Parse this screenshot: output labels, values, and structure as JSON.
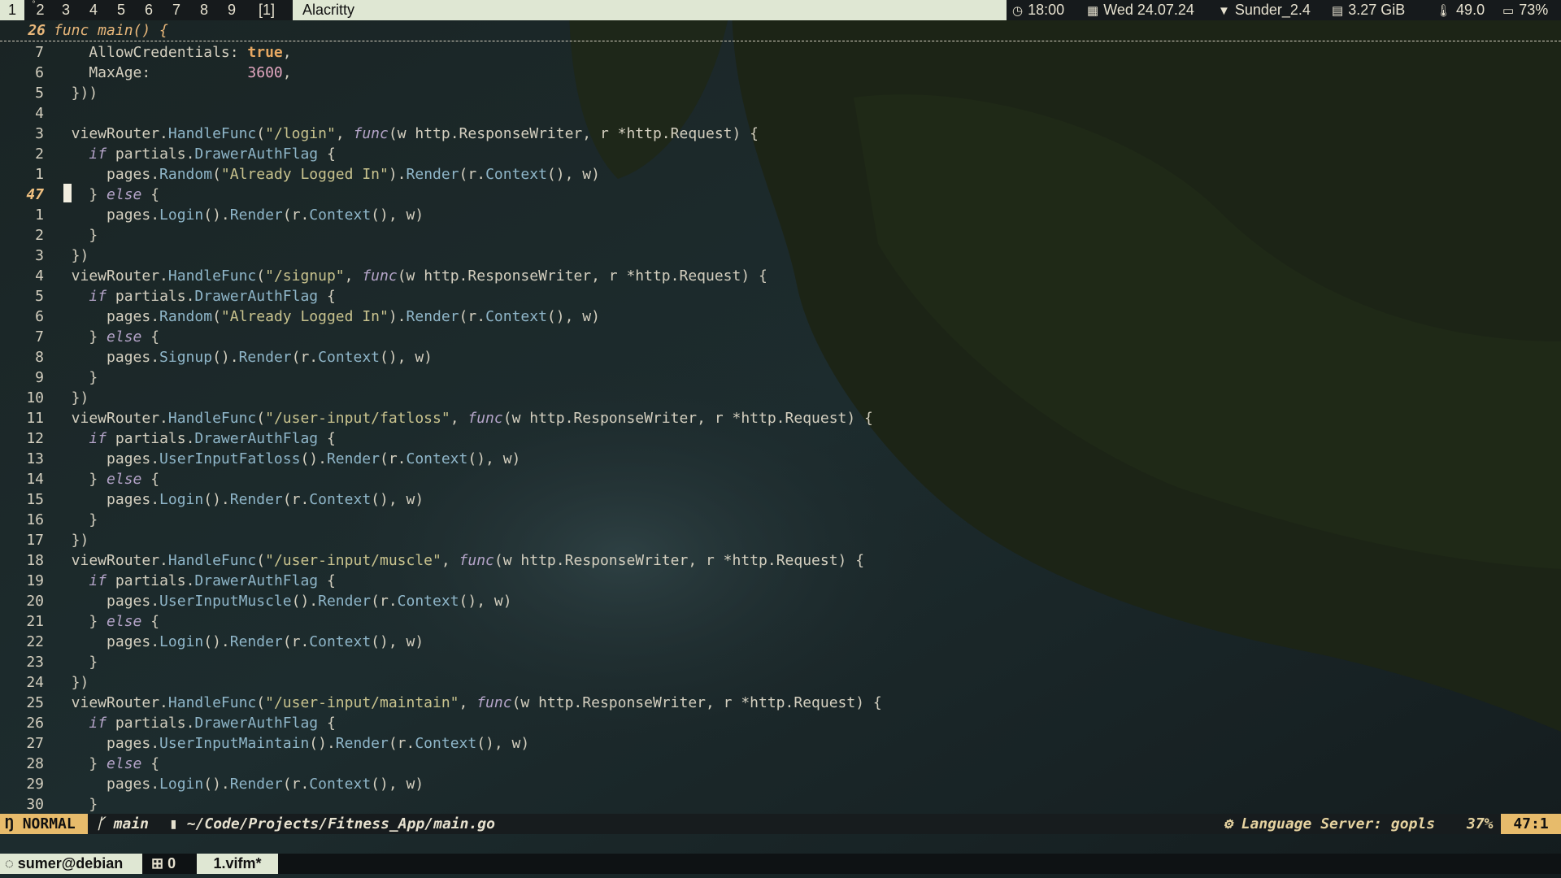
{
  "topbar": {
    "workspaces": [
      {
        "label": "1",
        "active": true
      },
      {
        "label": "2",
        "active": false,
        "sup": "°"
      },
      {
        "label": "3",
        "active": false
      },
      {
        "label": "4",
        "active": false
      },
      {
        "label": "5",
        "active": false
      },
      {
        "label": "6",
        "active": false
      },
      {
        "label": "7",
        "active": false
      },
      {
        "label": "8",
        "active": false
      },
      {
        "label": "9",
        "active": false
      },
      {
        "label": "[1]",
        "active": false
      }
    ],
    "window_title": "Alacritty",
    "status": {
      "time": "18:00",
      "date": "Wed 24.07.24",
      "wifi": "Sunder_2.4",
      "memory": "3.27 GiB",
      "temperature": "49.0",
      "battery": "73%"
    },
    "icons": {
      "clock": "clock-icon",
      "calendar": "calendar-icon",
      "wifi": "wifi-icon",
      "memory": "memory-icon",
      "temperature": "thermometer-icon",
      "battery": "battery-icon"
    }
  },
  "winbar": {
    "line_number": "26",
    "text": "func main() {"
  },
  "editor": {
    "lines": [
      {
        "n": "7",
        "tokens": [
          [
            "id",
            "    AllowCredentials: "
          ],
          [
            "bool",
            "true"
          ],
          [
            "id",
            ","
          ]
        ]
      },
      {
        "n": "6",
        "tokens": [
          [
            "id",
            "    MaxAge:           "
          ],
          [
            "numl",
            "3600"
          ],
          [
            "id",
            ","
          ]
        ]
      },
      {
        "n": "5",
        "tokens": [
          [
            "id",
            "  }))"
          ]
        ]
      },
      {
        "n": "4",
        "tokens": []
      },
      {
        "n": "3",
        "tokens": [
          [
            "id",
            "  viewRouter."
          ],
          [
            "fn",
            "HandleFunc"
          ],
          [
            "id",
            "("
          ],
          [
            "str",
            "\"/login\""
          ],
          [
            "id",
            ", "
          ],
          [
            "kw",
            "func"
          ],
          [
            "id",
            "(w http.ResponseWriter, r *http.Request) {"
          ]
        ]
      },
      {
        "n": "2",
        "tokens": [
          [
            "id",
            "    "
          ],
          [
            "kw",
            "if"
          ],
          [
            "id",
            " partials."
          ],
          [
            "fn",
            "DrawerAuthFlag"
          ],
          [
            "id",
            " {"
          ]
        ]
      },
      {
        "n": "1",
        "tokens": [
          [
            "id",
            "      pages."
          ],
          [
            "fn",
            "Random"
          ],
          [
            "id",
            "("
          ],
          [
            "str",
            "\"Already Logged In\""
          ],
          [
            "id",
            ")."
          ],
          [
            "fn",
            "Render"
          ],
          [
            "id",
            "(r."
          ],
          [
            "fn",
            "Context"
          ],
          [
            "id",
            "(), w)"
          ]
        ]
      },
      {
        "n": "47",
        "current": true,
        "tokens": [
          [
            "id",
            "    } "
          ],
          [
            "kw",
            "else"
          ],
          [
            "id",
            " {"
          ]
        ]
      },
      {
        "n": "1",
        "tokens": [
          [
            "id",
            "      pages."
          ],
          [
            "fn",
            "Login"
          ],
          [
            "id",
            "()."
          ],
          [
            "fn",
            "Render"
          ],
          [
            "id",
            "(r."
          ],
          [
            "fn",
            "Context"
          ],
          [
            "id",
            "(), w)"
          ]
        ]
      },
      {
        "n": "2",
        "tokens": [
          [
            "id",
            "    }"
          ]
        ]
      },
      {
        "n": "3",
        "tokens": [
          [
            "id",
            "  })"
          ]
        ]
      },
      {
        "n": "4",
        "tokens": [
          [
            "id",
            "  viewRouter."
          ],
          [
            "fn",
            "HandleFunc"
          ],
          [
            "id",
            "("
          ],
          [
            "str",
            "\"/signup\""
          ],
          [
            "id",
            ", "
          ],
          [
            "kw",
            "func"
          ],
          [
            "id",
            "(w http.ResponseWriter, r *http.Request) {"
          ]
        ]
      },
      {
        "n": "5",
        "tokens": [
          [
            "id",
            "    "
          ],
          [
            "kw",
            "if"
          ],
          [
            "id",
            " partials."
          ],
          [
            "fn",
            "DrawerAuthFlag"
          ],
          [
            "id",
            " {"
          ]
        ]
      },
      {
        "n": "6",
        "tokens": [
          [
            "id",
            "      pages."
          ],
          [
            "fn",
            "Random"
          ],
          [
            "id",
            "("
          ],
          [
            "str",
            "\"Already Logged In\""
          ],
          [
            "id",
            ")."
          ],
          [
            "fn",
            "Render"
          ],
          [
            "id",
            "(r."
          ],
          [
            "fn",
            "Context"
          ],
          [
            "id",
            "(), w)"
          ]
        ]
      },
      {
        "n": "7",
        "tokens": [
          [
            "id",
            "    } "
          ],
          [
            "kw",
            "else"
          ],
          [
            "id",
            " {"
          ]
        ]
      },
      {
        "n": "8",
        "tokens": [
          [
            "id",
            "      pages."
          ],
          [
            "fn",
            "Signup"
          ],
          [
            "id",
            "()."
          ],
          [
            "fn",
            "Render"
          ],
          [
            "id",
            "(r."
          ],
          [
            "fn",
            "Context"
          ],
          [
            "id",
            "(), w)"
          ]
        ]
      },
      {
        "n": "9",
        "tokens": [
          [
            "id",
            "    }"
          ]
        ]
      },
      {
        "n": "10",
        "tokens": [
          [
            "id",
            "  })"
          ]
        ]
      },
      {
        "n": "11",
        "tokens": [
          [
            "id",
            "  viewRouter."
          ],
          [
            "fn",
            "HandleFunc"
          ],
          [
            "id",
            "("
          ],
          [
            "str",
            "\"/user-input/fatloss\""
          ],
          [
            "id",
            ", "
          ],
          [
            "kw",
            "func"
          ],
          [
            "id",
            "(w http.ResponseWriter, r *http.Request) {"
          ]
        ]
      },
      {
        "n": "12",
        "tokens": [
          [
            "id",
            "    "
          ],
          [
            "kw",
            "if"
          ],
          [
            "id",
            " partials."
          ],
          [
            "fn",
            "DrawerAuthFlag"
          ],
          [
            "id",
            " {"
          ]
        ]
      },
      {
        "n": "13",
        "tokens": [
          [
            "id",
            "      pages."
          ],
          [
            "fn",
            "UserInputFatloss"
          ],
          [
            "id",
            "()."
          ],
          [
            "fn",
            "Render"
          ],
          [
            "id",
            "(r."
          ],
          [
            "fn",
            "Context"
          ],
          [
            "id",
            "(), w)"
          ]
        ]
      },
      {
        "n": "14",
        "tokens": [
          [
            "id",
            "    } "
          ],
          [
            "kw",
            "else"
          ],
          [
            "id",
            " {"
          ]
        ]
      },
      {
        "n": "15",
        "tokens": [
          [
            "id",
            "      pages."
          ],
          [
            "fn",
            "Login"
          ],
          [
            "id",
            "()."
          ],
          [
            "fn",
            "Render"
          ],
          [
            "id",
            "(r."
          ],
          [
            "fn",
            "Context"
          ],
          [
            "id",
            "(), w)"
          ]
        ]
      },
      {
        "n": "16",
        "tokens": [
          [
            "id",
            "    }"
          ]
        ]
      },
      {
        "n": "17",
        "tokens": [
          [
            "id",
            "  })"
          ]
        ]
      },
      {
        "n": "18",
        "tokens": [
          [
            "id",
            "  viewRouter."
          ],
          [
            "fn",
            "HandleFunc"
          ],
          [
            "id",
            "("
          ],
          [
            "str",
            "\"/user-input/muscle\""
          ],
          [
            "id",
            ", "
          ],
          [
            "kw",
            "func"
          ],
          [
            "id",
            "(w http.ResponseWriter, r *http.Request) {"
          ]
        ]
      },
      {
        "n": "19",
        "tokens": [
          [
            "id",
            "    "
          ],
          [
            "kw",
            "if"
          ],
          [
            "id",
            " partials."
          ],
          [
            "fn",
            "DrawerAuthFlag"
          ],
          [
            "id",
            " {"
          ]
        ]
      },
      {
        "n": "20",
        "tokens": [
          [
            "id",
            "      pages."
          ],
          [
            "fn",
            "UserInputMuscle"
          ],
          [
            "id",
            "()."
          ],
          [
            "fn",
            "Render"
          ],
          [
            "id",
            "(r."
          ],
          [
            "fn",
            "Context"
          ],
          [
            "id",
            "(), w)"
          ]
        ]
      },
      {
        "n": "21",
        "tokens": [
          [
            "id",
            "    } "
          ],
          [
            "kw",
            "else"
          ],
          [
            "id",
            " {"
          ]
        ]
      },
      {
        "n": "22",
        "tokens": [
          [
            "id",
            "      pages."
          ],
          [
            "fn",
            "Login"
          ],
          [
            "id",
            "()."
          ],
          [
            "fn",
            "Render"
          ],
          [
            "id",
            "(r."
          ],
          [
            "fn",
            "Context"
          ],
          [
            "id",
            "(), w)"
          ]
        ]
      },
      {
        "n": "23",
        "tokens": [
          [
            "id",
            "    }"
          ]
        ]
      },
      {
        "n": "24",
        "tokens": [
          [
            "id",
            "  })"
          ]
        ]
      },
      {
        "n": "25",
        "tokens": [
          [
            "id",
            "  viewRouter."
          ],
          [
            "fn",
            "HandleFunc"
          ],
          [
            "id",
            "("
          ],
          [
            "str",
            "\"/user-input/maintain\""
          ],
          [
            "id",
            ", "
          ],
          [
            "kw",
            "func"
          ],
          [
            "id",
            "(w http.ResponseWriter, r *http.Request) {"
          ]
        ]
      },
      {
        "n": "26",
        "tokens": [
          [
            "id",
            "    "
          ],
          [
            "kw",
            "if"
          ],
          [
            "id",
            " partials."
          ],
          [
            "fn",
            "DrawerAuthFlag"
          ],
          [
            "id",
            " {"
          ]
        ]
      },
      {
        "n": "27",
        "tokens": [
          [
            "id",
            "      pages."
          ],
          [
            "fn",
            "UserInputMaintain"
          ],
          [
            "id",
            "()."
          ],
          [
            "fn",
            "Render"
          ],
          [
            "id",
            "(r."
          ],
          [
            "fn",
            "Context"
          ],
          [
            "id",
            "(), w)"
          ]
        ]
      },
      {
        "n": "28",
        "tokens": [
          [
            "id",
            "    } "
          ],
          [
            "kw",
            "else"
          ],
          [
            "id",
            " {"
          ]
        ]
      },
      {
        "n": "29",
        "tokens": [
          [
            "id",
            "      pages."
          ],
          [
            "fn",
            "Login"
          ],
          [
            "id",
            "()."
          ],
          [
            "fn",
            "Render"
          ],
          [
            "id",
            "(r."
          ],
          [
            "fn",
            "Context"
          ],
          [
            "id",
            "(), w)"
          ]
        ]
      },
      {
        "n": "30",
        "tokens": [
          [
            "id",
            "    }"
          ]
        ]
      }
    ]
  },
  "statusline": {
    "mode": "NORMAL",
    "branch": "main",
    "filepath": "~/Code/Projects/Fitness_App/main.go",
    "lsp": "Language Server: gopls",
    "percent": "37%",
    "position": "47:1",
    "icons": {
      "mode": "neovim-icon",
      "branch": "git-branch-icon",
      "file": "file-icon",
      "lsp": "gears-icon"
    }
  },
  "tmux": {
    "session": "sumer@debian",
    "pane_count": "0",
    "window": "1.vifm*",
    "icons": {
      "session": "terminal-icon",
      "panes": "pane-icon"
    }
  },
  "colors": {
    "bar_bg": "#161a1c",
    "highlight": "#dfe7d3",
    "accent": "#e7bb6b",
    "keyword": "#b4a4c8",
    "function": "#8fb6c9",
    "string": "#c9c38e",
    "boolean": "#e7a862",
    "number": "#e3a7c0"
  }
}
